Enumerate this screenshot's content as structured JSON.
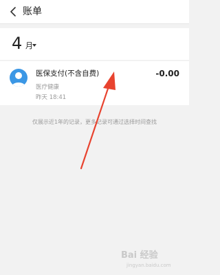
{
  "header": {
    "title": "账单",
    "back_icon": "chevron-left-icon"
  },
  "month_selector": {
    "month": "4",
    "suffix": "月",
    "dropdown_icon": "caret-down-icon"
  },
  "records": [
    {
      "title": "医保支付(不含自费)",
      "category": "医疗健康",
      "time": "昨天 18:41",
      "amount": "-0.00",
      "icon": "person-avatar-icon",
      "icon_color": "#3b97e5"
    }
  ],
  "notice": "仅展示近1年的记录，更多记录可通过选择时间查找",
  "annotation": {
    "type": "red-arrow",
    "color": "#e8432f"
  },
  "watermark": {
    "text": "Bai 经验",
    "sub": "jingyan.baidu.com"
  }
}
